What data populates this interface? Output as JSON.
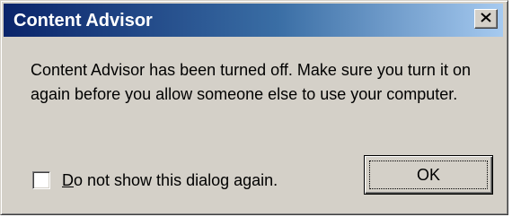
{
  "window": {
    "title": "Content Advisor",
    "close_icon": "close-icon"
  },
  "message": {
    "text": "Content Advisor has been turned off. Make sure you turn it on again before you allow someone else to use your computer."
  },
  "checkbox": {
    "label_accel": "D",
    "label_rest": "o not show this dialog again.",
    "checked": false
  },
  "buttons": {
    "ok_label": "OK"
  },
  "colors": {
    "titlebar_start": "#0a246a",
    "titlebar_end": "#a6caf0",
    "face": "#d4d0c8"
  }
}
